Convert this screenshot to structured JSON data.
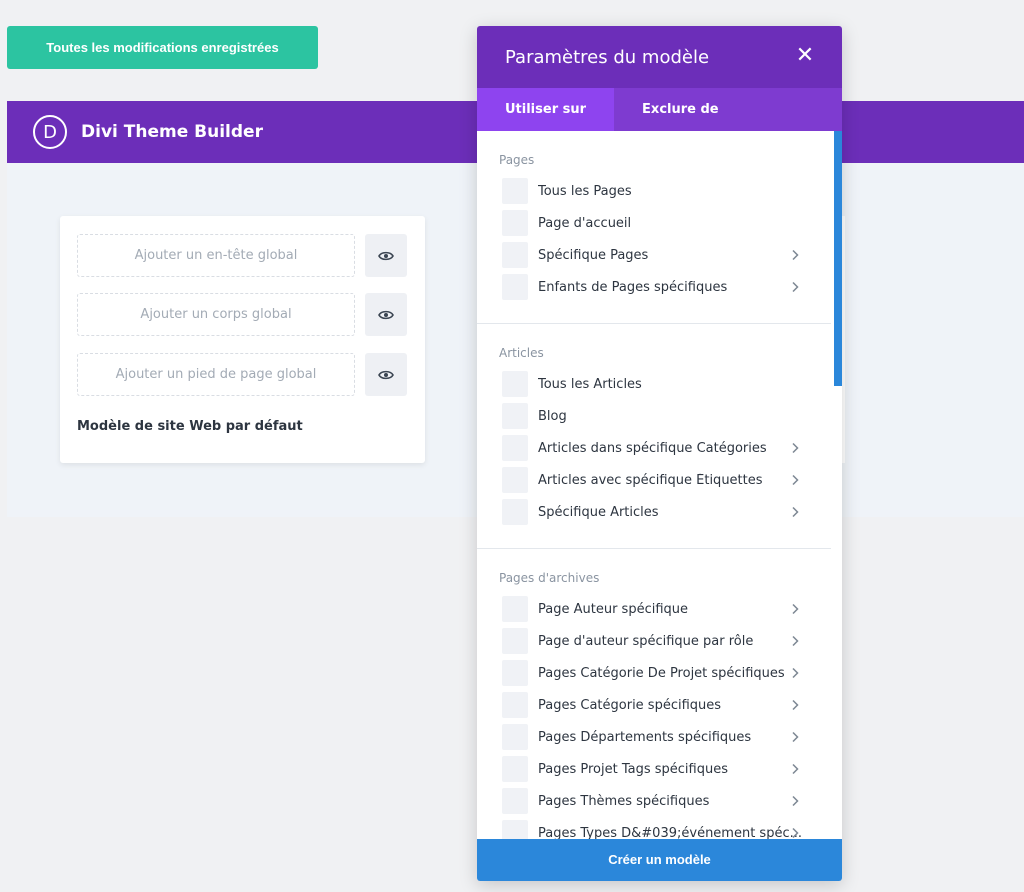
{
  "save_status": "Toutes les modifications enregistrées",
  "builder": {
    "logo_letter": "D",
    "title": "Divi Theme Builder"
  },
  "template_card": {
    "slots": [
      {
        "label": "Ajouter un en-tête global"
      },
      {
        "label": "Ajouter un corps global"
      },
      {
        "label": "Ajouter un pied de page global"
      }
    ],
    "name": "Modèle de site Web par défaut"
  },
  "modal": {
    "title": "Paramètres du modèle",
    "close_glyph": "✕",
    "tabs": [
      {
        "label": "Utiliser sur",
        "active": true
      },
      {
        "label": "Exclure de",
        "active": false
      }
    ],
    "sections": [
      {
        "title": "Pages",
        "items": [
          {
            "label": "Tous les Pages",
            "has_chevron": false
          },
          {
            "label": "Page d'accueil",
            "has_chevron": false
          },
          {
            "label": "Spécifique Pages",
            "has_chevron": true
          },
          {
            "label": "Enfants de Pages spécifiques",
            "has_chevron": true
          }
        ]
      },
      {
        "title": "Articles",
        "items": [
          {
            "label": "Tous les Articles",
            "has_chevron": false
          },
          {
            "label": "Blog",
            "has_chevron": false
          },
          {
            "label": "Articles dans spécifique Catégories",
            "has_chevron": true
          },
          {
            "label": "Articles avec spécifique Étiquettes",
            "has_chevron": true
          },
          {
            "label": "Spécifique Articles",
            "has_chevron": true
          }
        ]
      },
      {
        "title": "Pages d'archives",
        "items": [
          {
            "label": "Page Auteur spécifique",
            "has_chevron": true
          },
          {
            "label": "Page d'auteur spécifique par rôle",
            "has_chevron": true
          },
          {
            "label": "Pages Catégorie De Projet spécifiques",
            "has_chevron": true
          },
          {
            "label": "Pages Catégorie spécifiques",
            "has_chevron": true
          },
          {
            "label": "Pages Départements spécifiques",
            "has_chevron": true
          },
          {
            "label": "Pages Projet Tags spécifiques",
            "has_chevron": true
          },
          {
            "label": "Pages Thèmes spécifiques",
            "has_chevron": true
          },
          {
            "label": "Pages Types D&#039;événement spéc...",
            "has_chevron": true
          }
        ]
      }
    ],
    "create_button": "Créer un modèle"
  },
  "colors": {
    "purple_header": "#6c2eb9",
    "tab_bar": "#7e3bd0",
    "tab_active": "#8e44ef",
    "save_green": "#2cc4a1",
    "create_blue": "#2b87da"
  }
}
